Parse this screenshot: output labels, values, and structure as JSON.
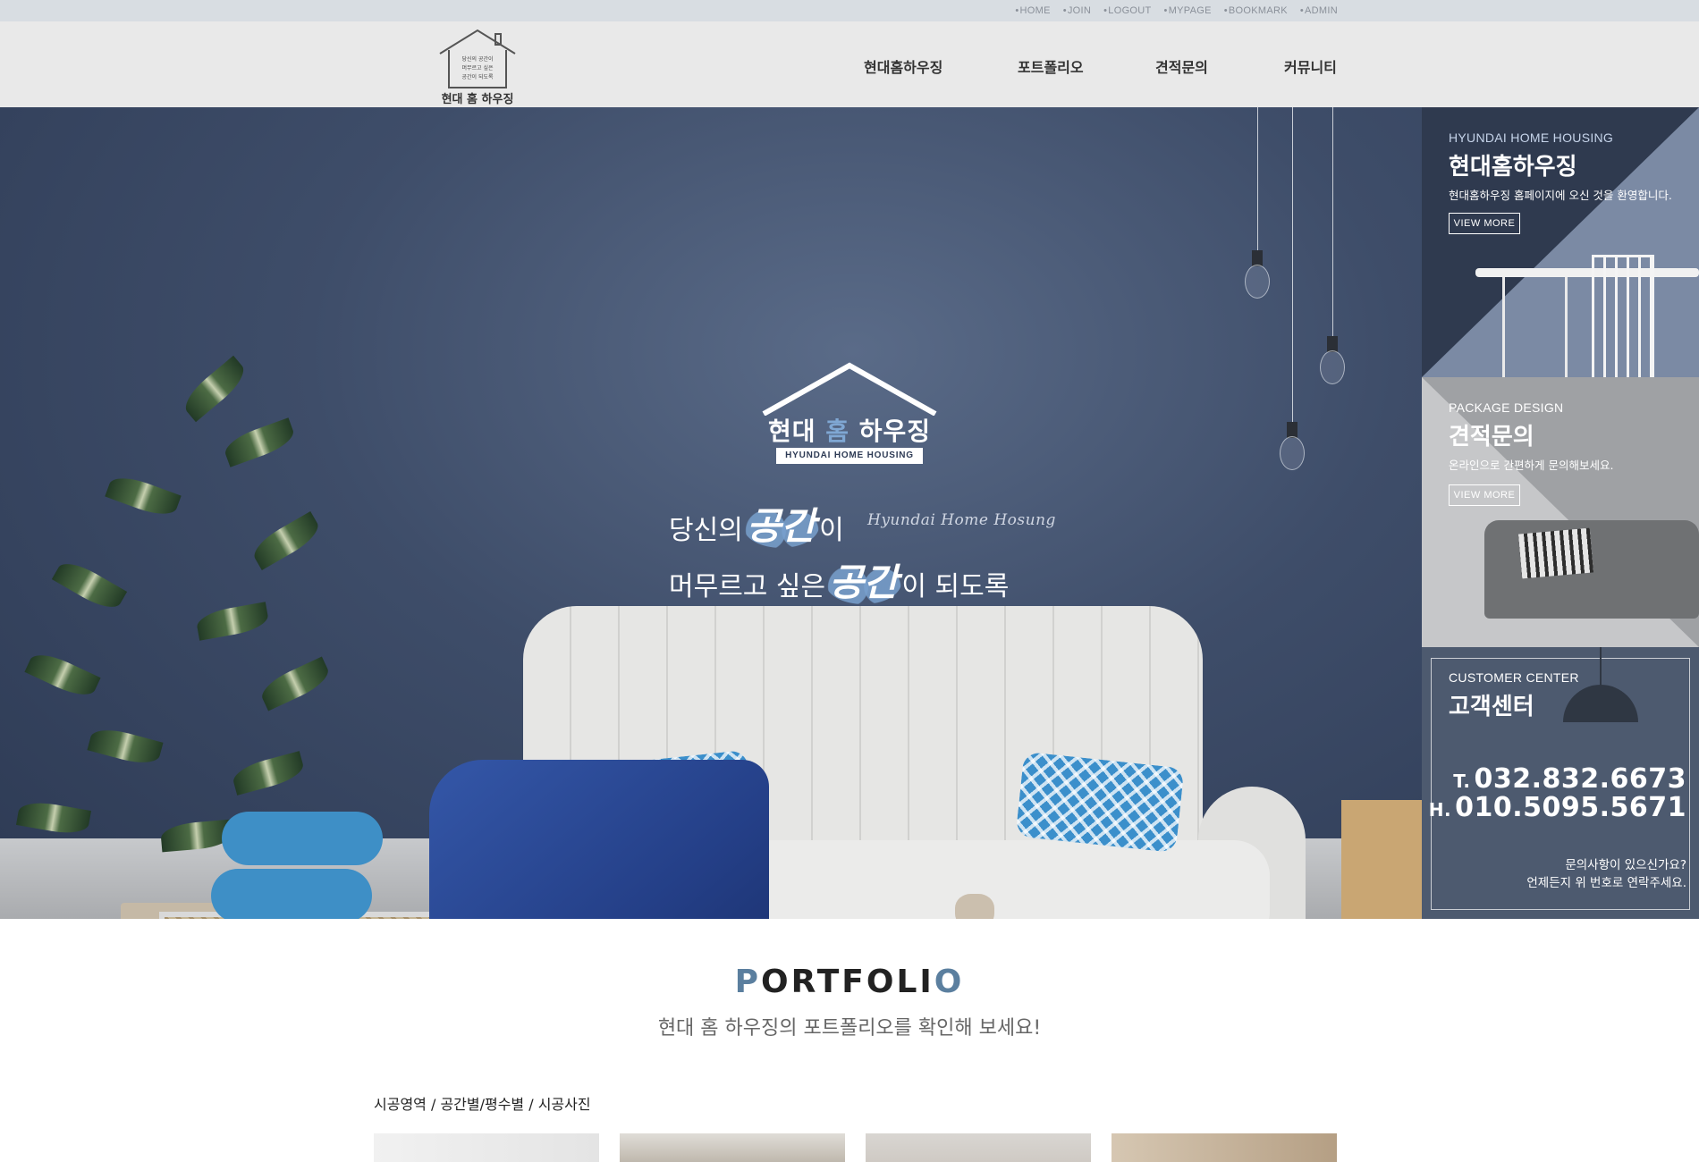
{
  "util_links": [
    "HOME",
    "JOIN",
    "LOGOUT",
    "MYPAGE",
    "BOOKMARK",
    "ADMIN"
  ],
  "logo": {
    "tagline_lines": [
      "당신의 공간이",
      "머무르고 싶은",
      "공간이 되도록"
    ],
    "name": "현대 홈 하우징"
  },
  "nav": [
    "현대홈하우징",
    "포트폴리오",
    "견적문의",
    "커뮤니티"
  ],
  "hero": {
    "logo_name_a": "현대",
    "logo_name_b": "홈",
    "logo_name_c": "하우징",
    "logo_sub": "HYUNDAI HOME HOUSING",
    "line1_pre": "당신의",
    "line1_em": "공간",
    "line1_post": "이",
    "line2_pre": "머무르고 싶은",
    "line2_em": "공간",
    "line2_post": "이 되도록",
    "script": "Hyundai Home Hosung",
    "slide_count": 3,
    "active_slide": 1
  },
  "panels": [
    {
      "en": "HYUNDAI HOME HOUSING",
      "ko": "현대홈하우징",
      "desc": "현대홈하우징 홈페이지에 오신 것을 환영합니다.",
      "button": "VIEW MORE"
    },
    {
      "en": "PACKAGE DESIGN",
      "ko": "견적문의",
      "desc": "온라인으로 간편하게 문의해보세요.",
      "button": "VIEW MORE"
    },
    {
      "en": "CUSTOMER CENTER",
      "ko": "고객센터",
      "tel_prefix": "T.",
      "tel": "032.832.6673",
      "hp_prefix": "H.",
      "hp": "010.5095.5671",
      "note1": "문의사항이 있으신가요?",
      "note2": "언제든지 위 번호로 연락주세요."
    }
  ],
  "portfolio": {
    "title_first": "P",
    "title_mid": "ORTFOLI",
    "title_last": "O",
    "subtitle": "현대 홈 하우징의 포트폴리오를 확인해 보세요!",
    "category_path": "시공영역 / 공간별/평수별 / 시공사진"
  },
  "colors": {
    "accent": "#5b7f9f",
    "hero_wall": "#3e4d69",
    "panel_dark": "#2f3a4f"
  }
}
